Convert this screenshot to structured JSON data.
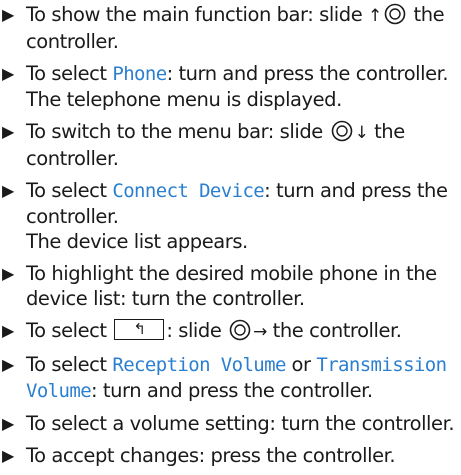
{
  "bullet": "▶",
  "steps": [
    {
      "pre": "To show the main function bar: slide ",
      "arrow": "↑",
      "post": " the controller."
    },
    {
      "pre": "To select ",
      "highlight": "Phone",
      "post": ": turn and press the controller.",
      "result": "The telephone menu is displayed."
    },
    {
      "pre": "To switch to the menu bar: slide ",
      "arrow": "↓",
      "post": " the controller."
    },
    {
      "pre": "To select ",
      "highlight": "Connect Device",
      "post": ": turn and press the controller.",
      "result": "The device list appears."
    },
    {
      "text": "To highlight the desired mobile phone in the device list: turn the controller."
    },
    {
      "pre": "To select ",
      "key_symbol": "↰",
      "mid": ": slide ",
      "arrow": "→",
      "post": " the controller."
    },
    {
      "pre": "To select ",
      "highlight": "Reception Volume",
      "mid": " or ",
      "highlight2": "Transmission Volume",
      "post": ": turn and press the controller."
    },
    {
      "text": "To select a volume setting: turn the controller."
    },
    {
      "text": "To accept changes: press the controller."
    }
  ],
  "colors": {
    "highlight": "#2b7fd0",
    "text": "#1a1a1a"
  },
  "icons": {
    "controller": "controller-icon"
  }
}
